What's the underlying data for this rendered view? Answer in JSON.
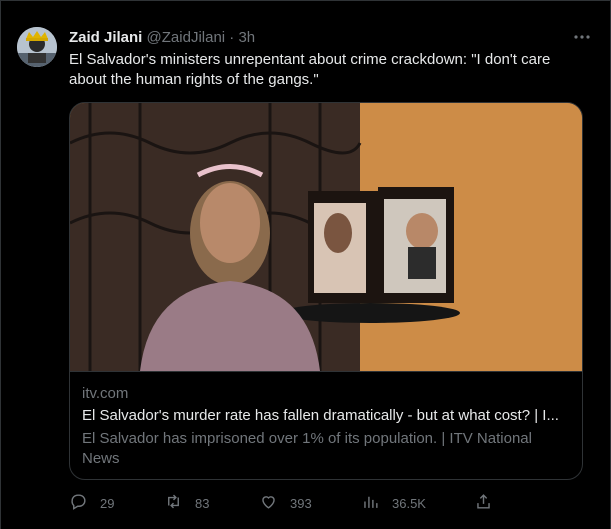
{
  "tweet": {
    "author_name": "Zaid Jilani",
    "author_handle": "@ZaidJilani",
    "separator": "·",
    "time": "3h",
    "text": "El Salvador's ministers unrepentant about crime crackdown: \"I don't care about the human rights of the gangs.\""
  },
  "card": {
    "domain": "itv.com",
    "title": "El Salvador's murder rate has fallen dramatically - but at what cost? | I...",
    "description": "El Salvador has imprisoned over 1% of its population. | ITV National News"
  },
  "actions": {
    "replies": "29",
    "retweets": "83",
    "likes": "393",
    "views": "36.5K"
  },
  "icons": {
    "more": "more-horizontal-icon",
    "reply": "reply-icon",
    "retweet": "retweet-icon",
    "like": "heart-icon",
    "views": "views-icon",
    "share": "share-icon"
  }
}
